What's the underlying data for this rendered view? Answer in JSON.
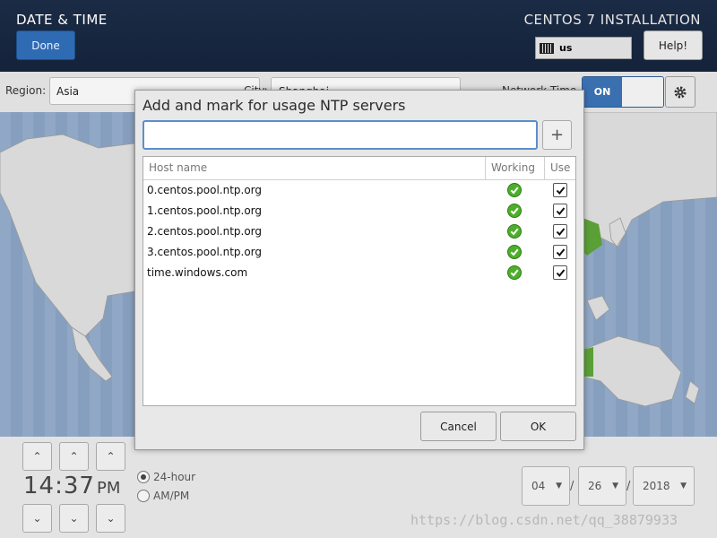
{
  "header": {
    "page_title": "DATE & TIME",
    "done_label": "Done",
    "install_title": "CENTOS 7 INSTALLATION",
    "keyboard_layout": "us",
    "help_label": "Help!"
  },
  "region_row": {
    "region_label": "Region:",
    "region_value": "Asia",
    "city_label": "City:",
    "city_value": "Shanghai",
    "network_time_label": "Network Time",
    "toggle_label": "ON"
  },
  "dialog": {
    "title": "Add and mark for usage NTP servers",
    "input_value": "",
    "add_label": "+",
    "columns": {
      "host": "Host name",
      "working": "Working",
      "use": "Use"
    },
    "servers": [
      {
        "host": "0.centos.pool.ntp.org",
        "working": true,
        "use": true
      },
      {
        "host": "1.centos.pool.ntp.org",
        "working": true,
        "use": true
      },
      {
        "host": "2.centos.pool.ntp.org",
        "working": true,
        "use": true
      },
      {
        "host": "3.centos.pool.ntp.org",
        "working": true,
        "use": true
      },
      {
        "host": "time.windows.com",
        "working": true,
        "use": true
      }
    ],
    "cancel_label": "Cancel",
    "ok_label": "OK"
  },
  "clock": {
    "hour": "14",
    "separator": ":",
    "minute": "37",
    "ampm": "PM",
    "format_24": "24-hour",
    "format_12": "AM/PM"
  },
  "date": {
    "month": "04",
    "day": "26",
    "year": "2018",
    "separator": "/"
  },
  "watermark": "https://blog.csdn.net/qq_38879933",
  "colors": {
    "header_bg": "#1b2b45",
    "accent_blue": "#2f6bb3",
    "working_green": "#4caf2a",
    "map_ocean": "#8ea6c4"
  }
}
